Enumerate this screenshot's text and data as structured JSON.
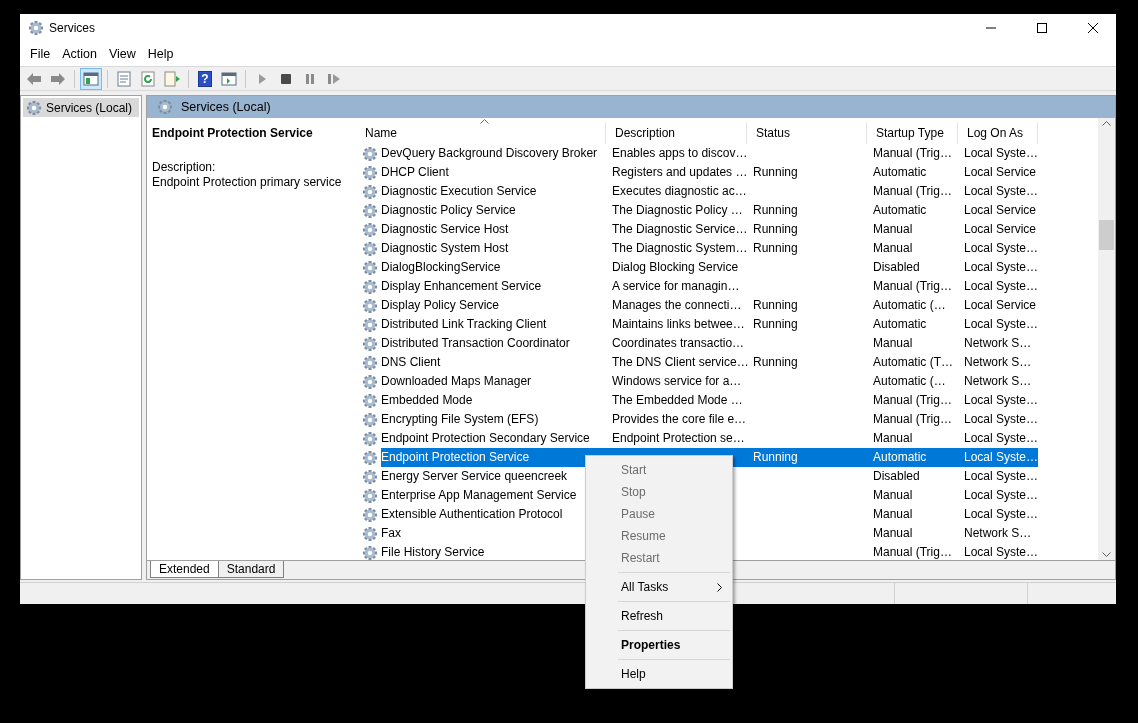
{
  "window": {
    "title": "Services"
  },
  "menubar": [
    "File",
    "Action",
    "View",
    "Help"
  ],
  "toolbar": [
    {
      "buttons": [
        {
          "kind": "back",
          "pressed": false
        },
        {
          "kind": "forward",
          "pressed": false
        }
      ]
    },
    {
      "buttons": [
        {
          "kind": "tree",
          "pressed": true
        }
      ]
    },
    {
      "buttons": [
        {
          "kind": "properties",
          "pressed": false
        },
        {
          "kind": "refresh",
          "pressed": false
        },
        {
          "kind": "export",
          "pressed": false
        }
      ]
    },
    {
      "buttons": [
        {
          "kind": "help",
          "label": "?",
          "pressed": false
        },
        {
          "kind": "console",
          "pressed": false
        }
      ]
    },
    {
      "buttons": [
        {
          "kind": "play",
          "pressed": false
        },
        {
          "kind": "stop",
          "pressed": false
        },
        {
          "kind": "pause",
          "pressed": false
        },
        {
          "kind": "resume",
          "pressed": false
        }
      ]
    }
  ],
  "tree": {
    "items": [
      {
        "label": "Services (Local)",
        "selected": true
      }
    ]
  },
  "pane": {
    "title": "Services (Local)"
  },
  "details": {
    "title": "Endpoint Protection Service",
    "label": "Description:",
    "text": "Endpoint Protection primary service"
  },
  "table": {
    "columns": [
      {
        "label": "Name",
        "sorted": true
      },
      {
        "label": "Description",
        "sorted": false
      },
      {
        "label": "Status",
        "sorted": false
      },
      {
        "label": "Startup Type",
        "sorted": false
      },
      {
        "label": "Log On As",
        "sorted": false
      }
    ],
    "rows": [
      {
        "name": "DevQuery Background Discovery Broker",
        "description": "Enables apps to discov…",
        "status": "",
        "startup": "Manual (Trig…",
        "logon": "Local Syste…",
        "selected": false
      },
      {
        "name": "DHCP Client",
        "description": "Registers and updates …",
        "status": "Running",
        "startup": "Automatic",
        "logon": "Local Service",
        "selected": false
      },
      {
        "name": "Diagnostic Execution Service",
        "description": "Executes diagnostic ac…",
        "status": "",
        "startup": "Manual (Trig…",
        "logon": "Local Syste…",
        "selected": false
      },
      {
        "name": "Diagnostic Policy Service",
        "description": "The Diagnostic Policy …",
        "status": "Running",
        "startup": "Automatic",
        "logon": "Local Service",
        "selected": false
      },
      {
        "name": "Diagnostic Service Host",
        "description": "The Diagnostic Service…",
        "status": "Running",
        "startup": "Manual",
        "logon": "Local Service",
        "selected": false
      },
      {
        "name": "Diagnostic System Host",
        "description": "The Diagnostic System…",
        "status": "Running",
        "startup": "Manual",
        "logon": "Local Syste…",
        "selected": false
      },
      {
        "name": "DialogBlockingService",
        "description": "Dialog Blocking Service",
        "status": "",
        "startup": "Disabled",
        "logon": "Local Syste…",
        "selected": false
      },
      {
        "name": "Display Enhancement Service",
        "description": "A service for managin…",
        "status": "",
        "startup": "Manual (Trig…",
        "logon": "Local Syste…",
        "selected": false
      },
      {
        "name": "Display Policy Service",
        "description": "Manages the connecti…",
        "status": "Running",
        "startup": "Automatic (…",
        "logon": "Local Service",
        "selected": false
      },
      {
        "name": "Distributed Link Tracking Client",
        "description": "Maintains links betwee…",
        "status": "Running",
        "startup": "Automatic",
        "logon": "Local Syste…",
        "selected": false
      },
      {
        "name": "Distributed Transaction Coordinator",
        "description": "Coordinates transactio…",
        "status": "",
        "startup": "Manual",
        "logon": "Network S…",
        "selected": false
      },
      {
        "name": "DNS Client",
        "description": "The DNS Client service…",
        "status": "Running",
        "startup": "Automatic (T…",
        "logon": "Network S…",
        "selected": false
      },
      {
        "name": "Downloaded Maps Manager",
        "description": "Windows service for a…",
        "status": "",
        "startup": "Automatic (…",
        "logon": "Network S…",
        "selected": false
      },
      {
        "name": "Embedded Mode",
        "description": "The Embedded Mode …",
        "status": "",
        "startup": "Manual (Trig…",
        "logon": "Local Syste…",
        "selected": false
      },
      {
        "name": "Encrypting File System (EFS)",
        "description": "Provides the core file e…",
        "status": "",
        "startup": "Manual (Trig…",
        "logon": "Local Syste…",
        "selected": false
      },
      {
        "name": "Endpoint Protection Secondary Service",
        "description": "Endpoint Protection se…",
        "status": "",
        "startup": "Manual",
        "logon": "Local Syste…",
        "selected": false
      },
      {
        "name": "Endpoint Protection Service",
        "status": "Running",
        "startup": "Automatic",
        "logon": "Local Syste…",
        "selected": true
      },
      {
        "name": "Energy Server Service queencreek",
        "status": "",
        "startup": "Disabled",
        "logon": "Local Syste…",
        "selected": false
      },
      {
        "name": "Enterprise App Management Service",
        "status": "",
        "startup": "Manual",
        "logon": "Local Syste…",
        "selected": false
      },
      {
        "name": "Extensible Authentication Protocol",
        "status": "",
        "startup": "Manual",
        "logon": "Local Syste…",
        "selected": false
      },
      {
        "name": "Fax",
        "status": "",
        "startup": "Manual",
        "logon": "Network S…",
        "selected": false
      },
      {
        "name": "File History Service",
        "status": "",
        "startup": "Manual (Trig…",
        "logon": "Local Syste…",
        "selected": false
      }
    ]
  },
  "view_tabs": [
    {
      "label": "Extended",
      "selected": true
    },
    {
      "label": "Standard",
      "selected": false
    }
  ],
  "context_menu": [
    {
      "kind": "item",
      "label": "Start",
      "disabled": true
    },
    {
      "kind": "item",
      "label": "Stop",
      "disabled": true
    },
    {
      "kind": "item",
      "label": "Pause",
      "disabled": true
    },
    {
      "kind": "item",
      "label": "Resume",
      "disabled": true
    },
    {
      "kind": "item",
      "label": "Restart",
      "disabled": true
    },
    {
      "kind": "separator"
    },
    {
      "kind": "submenu",
      "label": "All Tasks",
      "disabled": false
    },
    {
      "kind": "separator"
    },
    {
      "kind": "item",
      "label": "Refresh",
      "disabled": false
    },
    {
      "kind": "separator"
    },
    {
      "kind": "default",
      "label": "Properties",
      "disabled": false
    },
    {
      "kind": "separator"
    },
    {
      "kind": "item",
      "label": "Help",
      "disabled": false
    }
  ]
}
